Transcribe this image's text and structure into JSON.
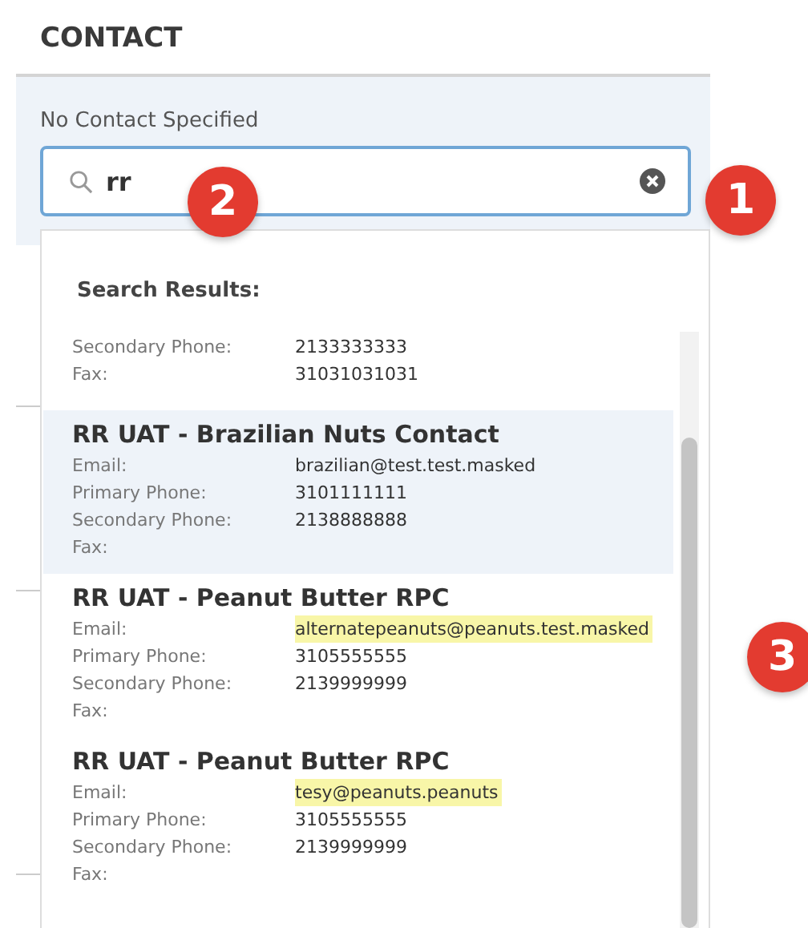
{
  "section_title": "CONTACT",
  "contact_label": "No Contact Specified",
  "search": {
    "value": "rr"
  },
  "results_heading": "Search Results:",
  "results": [
    {
      "selected": false,
      "fields": [
        {
          "label": "Secondary Phone:",
          "value": "2133333333"
        },
        {
          "label": "Fax:",
          "value": "31031031031"
        }
      ]
    },
    {
      "title": "RR UAT - Brazilian Nuts Contact",
      "selected": true,
      "fields": [
        {
          "label": "Email:",
          "value": "brazilian@test.test.masked",
          "highlighted": false
        },
        {
          "label": "Primary Phone:",
          "value": "3101111111"
        },
        {
          "label": "Secondary Phone:",
          "value": "2138888888"
        },
        {
          "label": "Fax:"
        }
      ]
    },
    {
      "title": "RR UAT - Peanut Butter RPC",
      "selected": false,
      "fields": [
        {
          "label": "Email:",
          "value": "alternatepeanuts@peanuts.test.masked",
          "highlighted": true
        },
        {
          "label": "Primary Phone:",
          "value": "3105555555"
        },
        {
          "label": "Secondary Phone:",
          "value": "2139999999"
        },
        {
          "label": "Fax:"
        }
      ]
    },
    {
      "title": "RR UAT - Peanut Butter RPC",
      "selected": false,
      "fields": [
        {
          "label": "Email:",
          "value": "tesy@peanuts.peanuts",
          "highlighted": true
        },
        {
          "label": "Primary Phone:",
          "value": "3105555555"
        },
        {
          "label": "Secondary Phone:",
          "value": "2139999999"
        },
        {
          "label": "Fax:"
        }
      ]
    }
  ],
  "callouts": [
    "1",
    "2",
    "3"
  ]
}
